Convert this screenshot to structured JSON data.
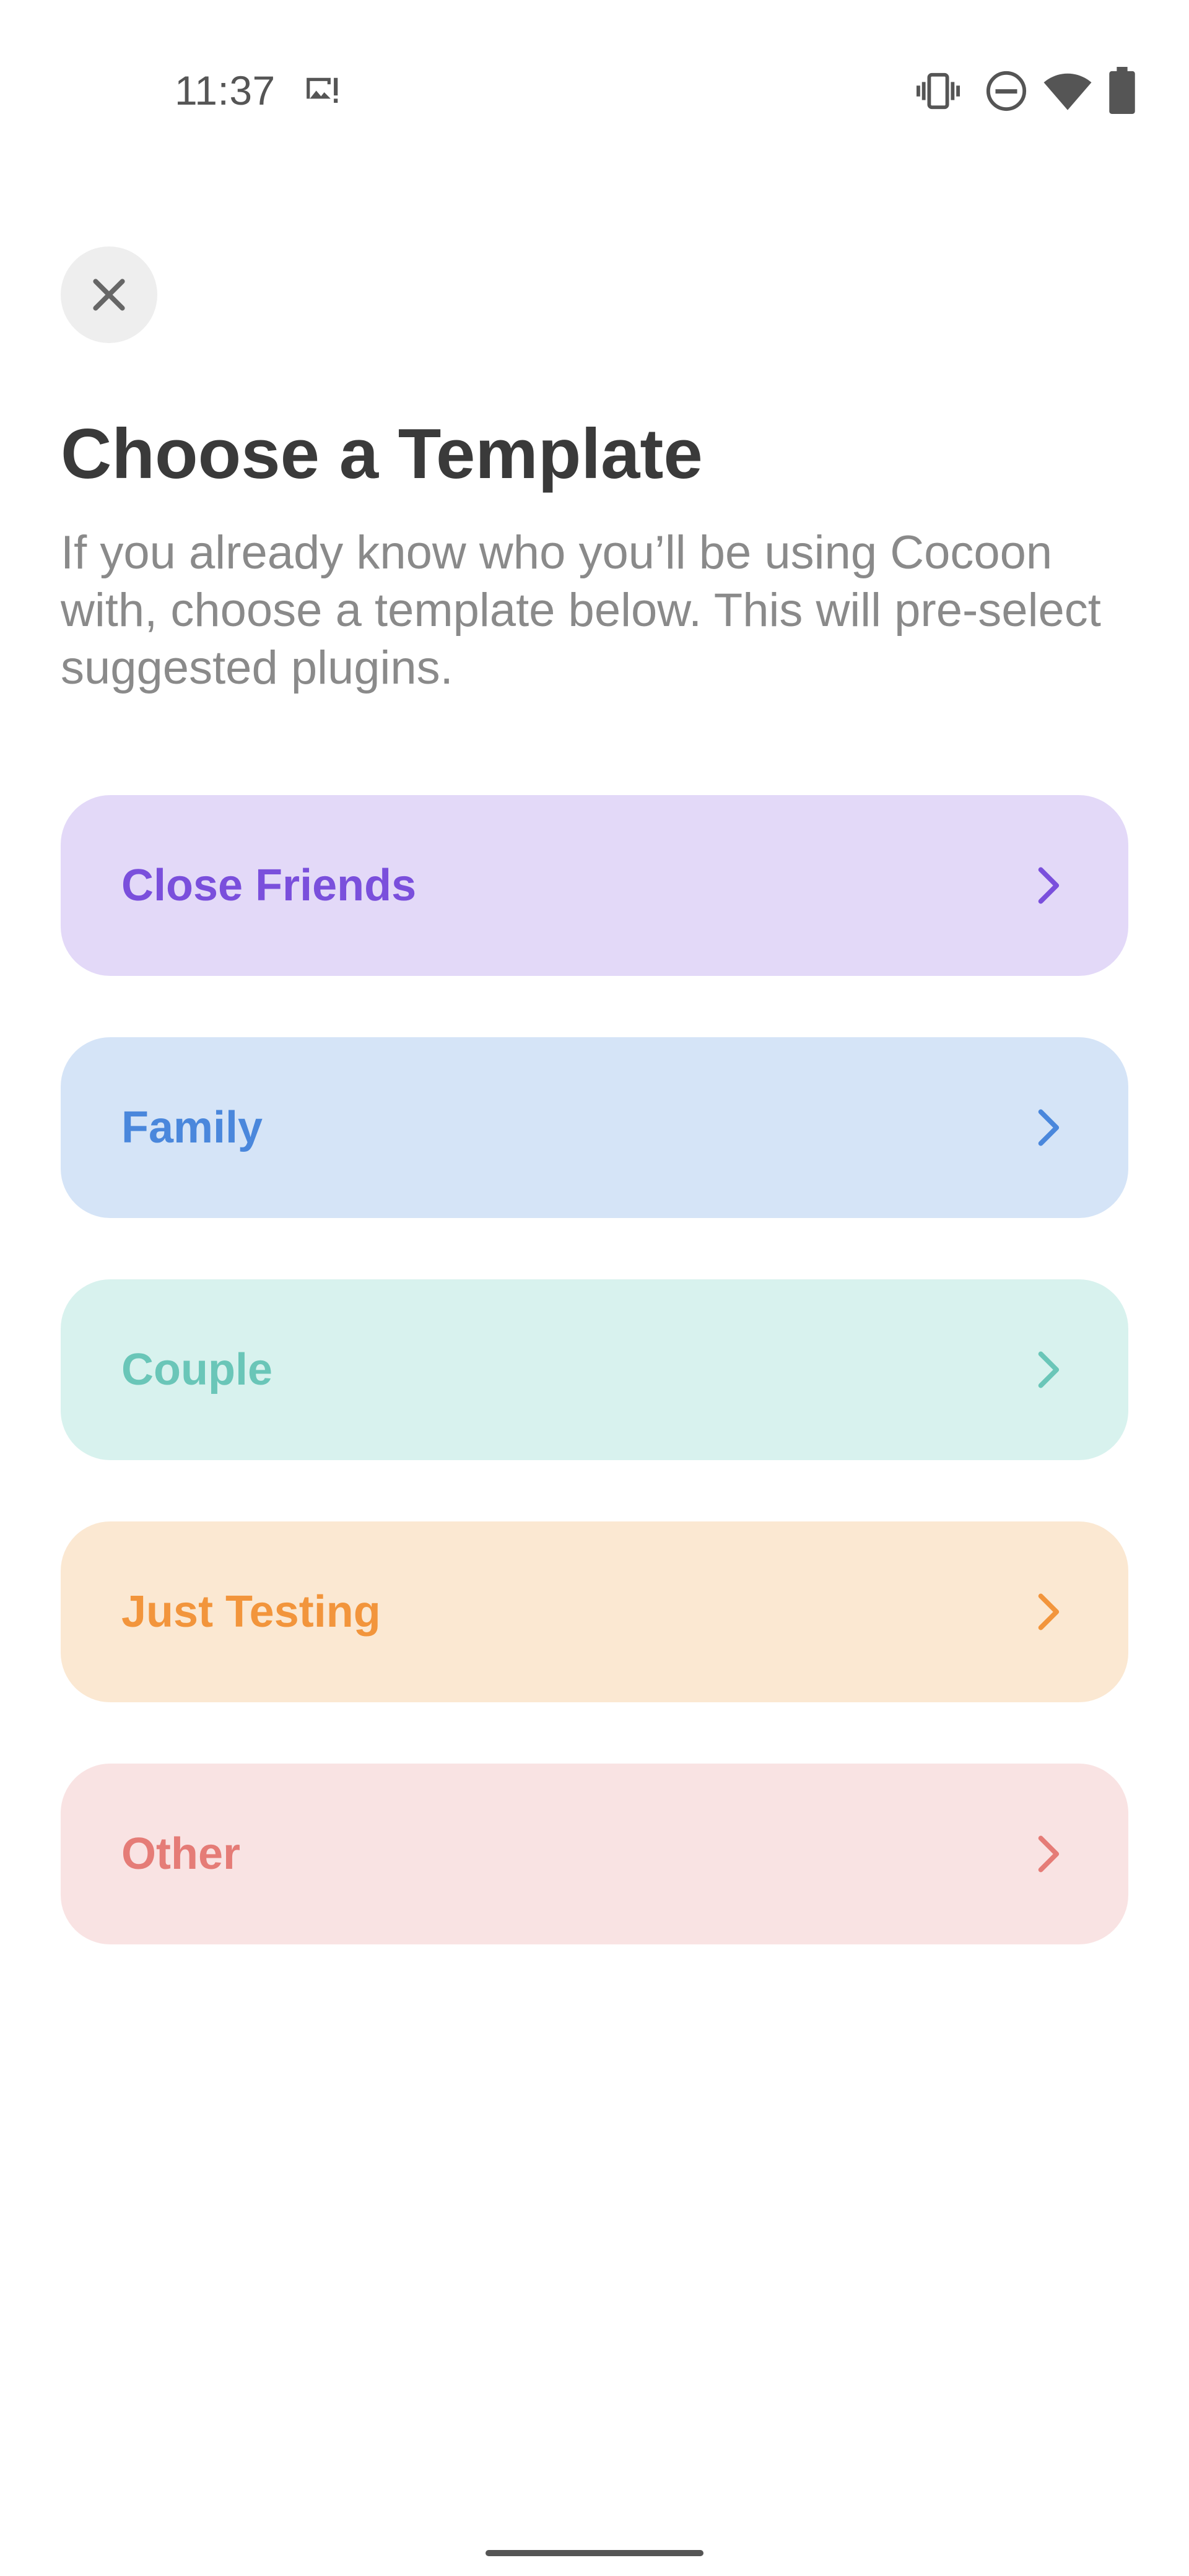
{
  "status_bar": {
    "time": "11:37",
    "icons": [
      "image-alert-icon",
      "vibrate-icon",
      "do-not-disturb-icon",
      "wifi-icon",
      "battery-icon"
    ]
  },
  "header": {
    "close_icon": "close-icon",
    "title": "Choose a Template",
    "subtitle": "If you already know who you’ll be using Cocoon with, choose a template below. This will pre-select suggested plugins."
  },
  "templates": [
    {
      "label": "Close Friends",
      "color": "#7a4fdc",
      "background": "#e3d9f8",
      "icon": "chevron-right-icon"
    },
    {
      "label": "Family",
      "color": "#4a87dc",
      "background": "#d5e4f7",
      "icon": "chevron-right-icon"
    },
    {
      "label": "Couple",
      "color": "#6ac6b8",
      "background": "#d8f2ee",
      "icon": "chevron-right-icon"
    },
    {
      "label": "Just Testing",
      "color": "#f2953c",
      "background": "#fbe8d2",
      "icon": "chevron-right-icon"
    },
    {
      "label": "Other",
      "color": "#e57c77",
      "background": "#f9e3e3",
      "icon": "chevron-right-icon"
    }
  ]
}
